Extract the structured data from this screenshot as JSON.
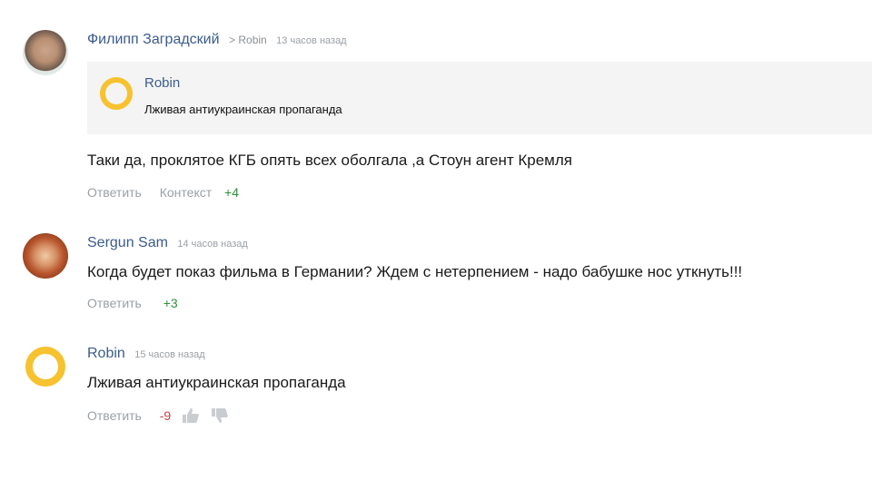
{
  "comments": [
    {
      "author": "Филипп Заградский",
      "reply_to": "> Robin",
      "time": "13 часов назад",
      "quote": {
        "author": "Robin",
        "text": "Лживая антиукраинская пропаганда"
      },
      "text": "Таки да, проклятое КГБ опять всех оболгала ,а Стоун агент Кремля",
      "actions": {
        "reply": "Ответить",
        "context": "Контекст",
        "score": "+4"
      }
    },
    {
      "author": "Sergun Sam",
      "time": "14 часов назад",
      "text": "Когда будет показ фильма в Германии? Ждем с нетерпением - надо бабушке нос уткнуть!!!",
      "actions": {
        "reply": "Ответить",
        "score": "+3"
      }
    },
    {
      "author": "Robin",
      "time": "15 часов назад",
      "text": "Лживая антиукраинская пропаганда",
      "actions": {
        "reply": "Ответить",
        "score": "-9",
        "like_icon": "thumbs-up-icon",
        "dislike_icon": "thumbs-down-icon"
      }
    }
  ],
  "colors": {
    "author": "#3b5b8c",
    "muted": "#9aa0a6",
    "positive": "#2f8f3c",
    "negative": "#d23b3b",
    "avatar_ring": "#f7c230"
  }
}
